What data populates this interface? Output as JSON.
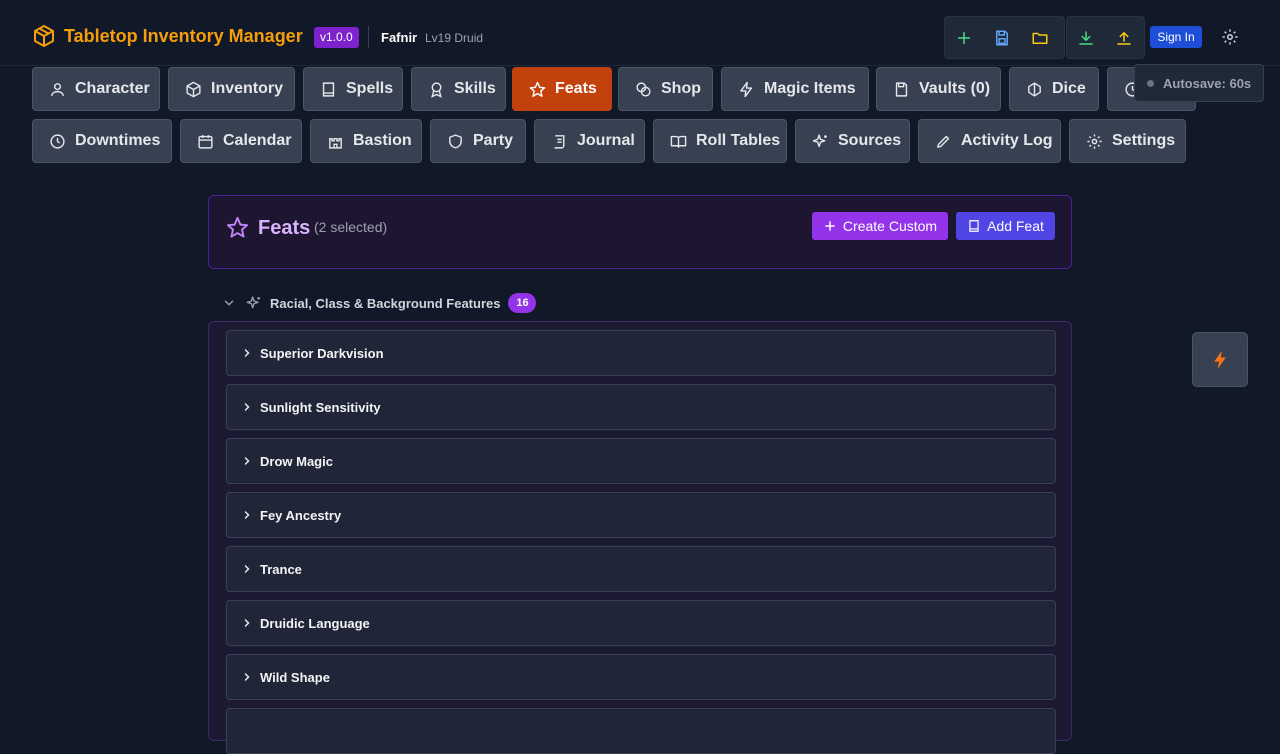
{
  "app": {
    "title": "Tabletop Inventory Manager",
    "version": "v1.0.0",
    "character_name": "Fafnir",
    "character_level": "Lv19 Druid"
  },
  "toolbar": {
    "sign_in_label": "Sign In",
    "icons": [
      "plus-icon",
      "save-icon",
      "folder-icon",
      "download-icon",
      "upload-icon",
      "gear-icon"
    ]
  },
  "tabs": {
    "character": "Character",
    "inventory": "Inventory",
    "spells": "Spells",
    "skills": "Skills",
    "feats": "Feats",
    "shop": "Shop",
    "magic_items": "Magic Items",
    "vaults": "Vaults (0)",
    "dice": "Dice",
    "downtimes": "Downtimes",
    "calendar": "Calendar",
    "bastion": "Bastion",
    "party": "Party",
    "journal": "Journal",
    "roll_tables": "Roll Tables",
    "sources": "Sources",
    "activity_log": "Activity Log",
    "settings": "Settings",
    "active": "Feats"
  },
  "autosave": {
    "label": "Autosave: 60s"
  },
  "feats_panel": {
    "title": "Feats",
    "selected_count": "(2 selected)",
    "create_custom_label": "Create Custom",
    "add_feat_label": "Add Feat"
  },
  "features_section": {
    "label": "Racial, Class & Background Features",
    "count": "16",
    "items": [
      "Superior Darkvision",
      "Sunlight Sensitivity",
      "Drow Magic",
      "Fey Ancestry",
      "Trance",
      "Druidic Language",
      "Wild Shape"
    ]
  },
  "colors": {
    "accent_active_tab": "#c2410c",
    "brand": "#f59e0b",
    "purple": "#9333ea",
    "indigo": "#4f46e5"
  }
}
